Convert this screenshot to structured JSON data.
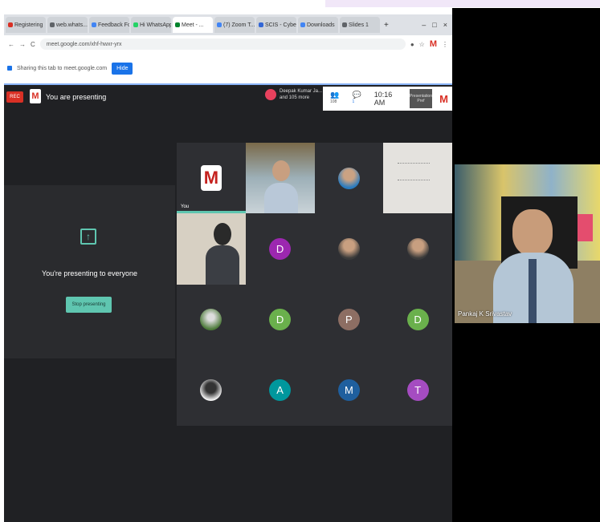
{
  "browser": {
    "tabs": [
      {
        "label": "Registering",
        "color": "#d93025"
      },
      {
        "label": "web.whats...",
        "color": "#5f6368"
      },
      {
        "label": "Feedback Form",
        "color": "#4285f4"
      },
      {
        "label": "Hi WhatsApp",
        "color": "#25d366"
      },
      {
        "label": "Meet - ...",
        "color": "#00832d",
        "active": true
      },
      {
        "label": "(7) Zoom T...",
        "color": "#4285f4"
      },
      {
        "label": "SCIS - Cyber",
        "color": "#3367d6"
      },
      {
        "label": "Downloads",
        "color": "#4285f4"
      },
      {
        "label": "Slides 1",
        "color": "#5f6368"
      }
    ],
    "window_controls": [
      "–",
      "□",
      "×"
    ],
    "url": "meet.google.com/xhf-hwxr-yrx",
    "new_tab": "+",
    "nav": [
      "←",
      "→",
      "C"
    ]
  },
  "sharebar": {
    "text": "Sharing this tab to meet.google.com",
    "hide_label": "Hide"
  },
  "meet": {
    "rec_label": "REC",
    "logo_letter": "M",
    "presenting_label": "You are presenting",
    "participants_text": "Deepak Kumar Ja... and 105 more",
    "people_count": "108",
    "chat_badge": "1",
    "time": "10:16 AM",
    "presenter_tag": "Presentation Pref",
    "present_card": {
      "message": "You're presenting to everyone",
      "stop_label": "Stop presenting"
    },
    "self_label": "You",
    "tiles": [
      {
        "kind": "mlogo",
        "letter": "M",
        "self": true
      },
      {
        "kind": "classcam"
      },
      {
        "kind": "photo",
        "style": "blue"
      },
      {
        "kind": "board"
      },
      {
        "kind": "room"
      },
      {
        "kind": "avatar",
        "letter": "D",
        "color": "#9c27b0"
      },
      {
        "kind": "photo",
        "style": "default"
      },
      {
        "kind": "photo",
        "style": "default"
      },
      {
        "kind": "photo",
        "style": "green"
      },
      {
        "kind": "avatar",
        "letter": "D",
        "color": "#6ab04c"
      },
      {
        "kind": "avatar",
        "letter": "P",
        "color": "#8d6e63"
      },
      {
        "kind": "avatar",
        "letter": "D",
        "color": "#6ab04c"
      },
      {
        "kind": "photo",
        "style": "bw"
      },
      {
        "kind": "avatar",
        "letter": "A",
        "color": "#00979d"
      },
      {
        "kind": "avatar",
        "letter": "M",
        "color": "#1f5f9e"
      },
      {
        "kind": "avatar",
        "letter": "T",
        "color": "#a54cc1"
      }
    ]
  },
  "presenter_video": {
    "name": "Pankaj K Srivastav"
  }
}
